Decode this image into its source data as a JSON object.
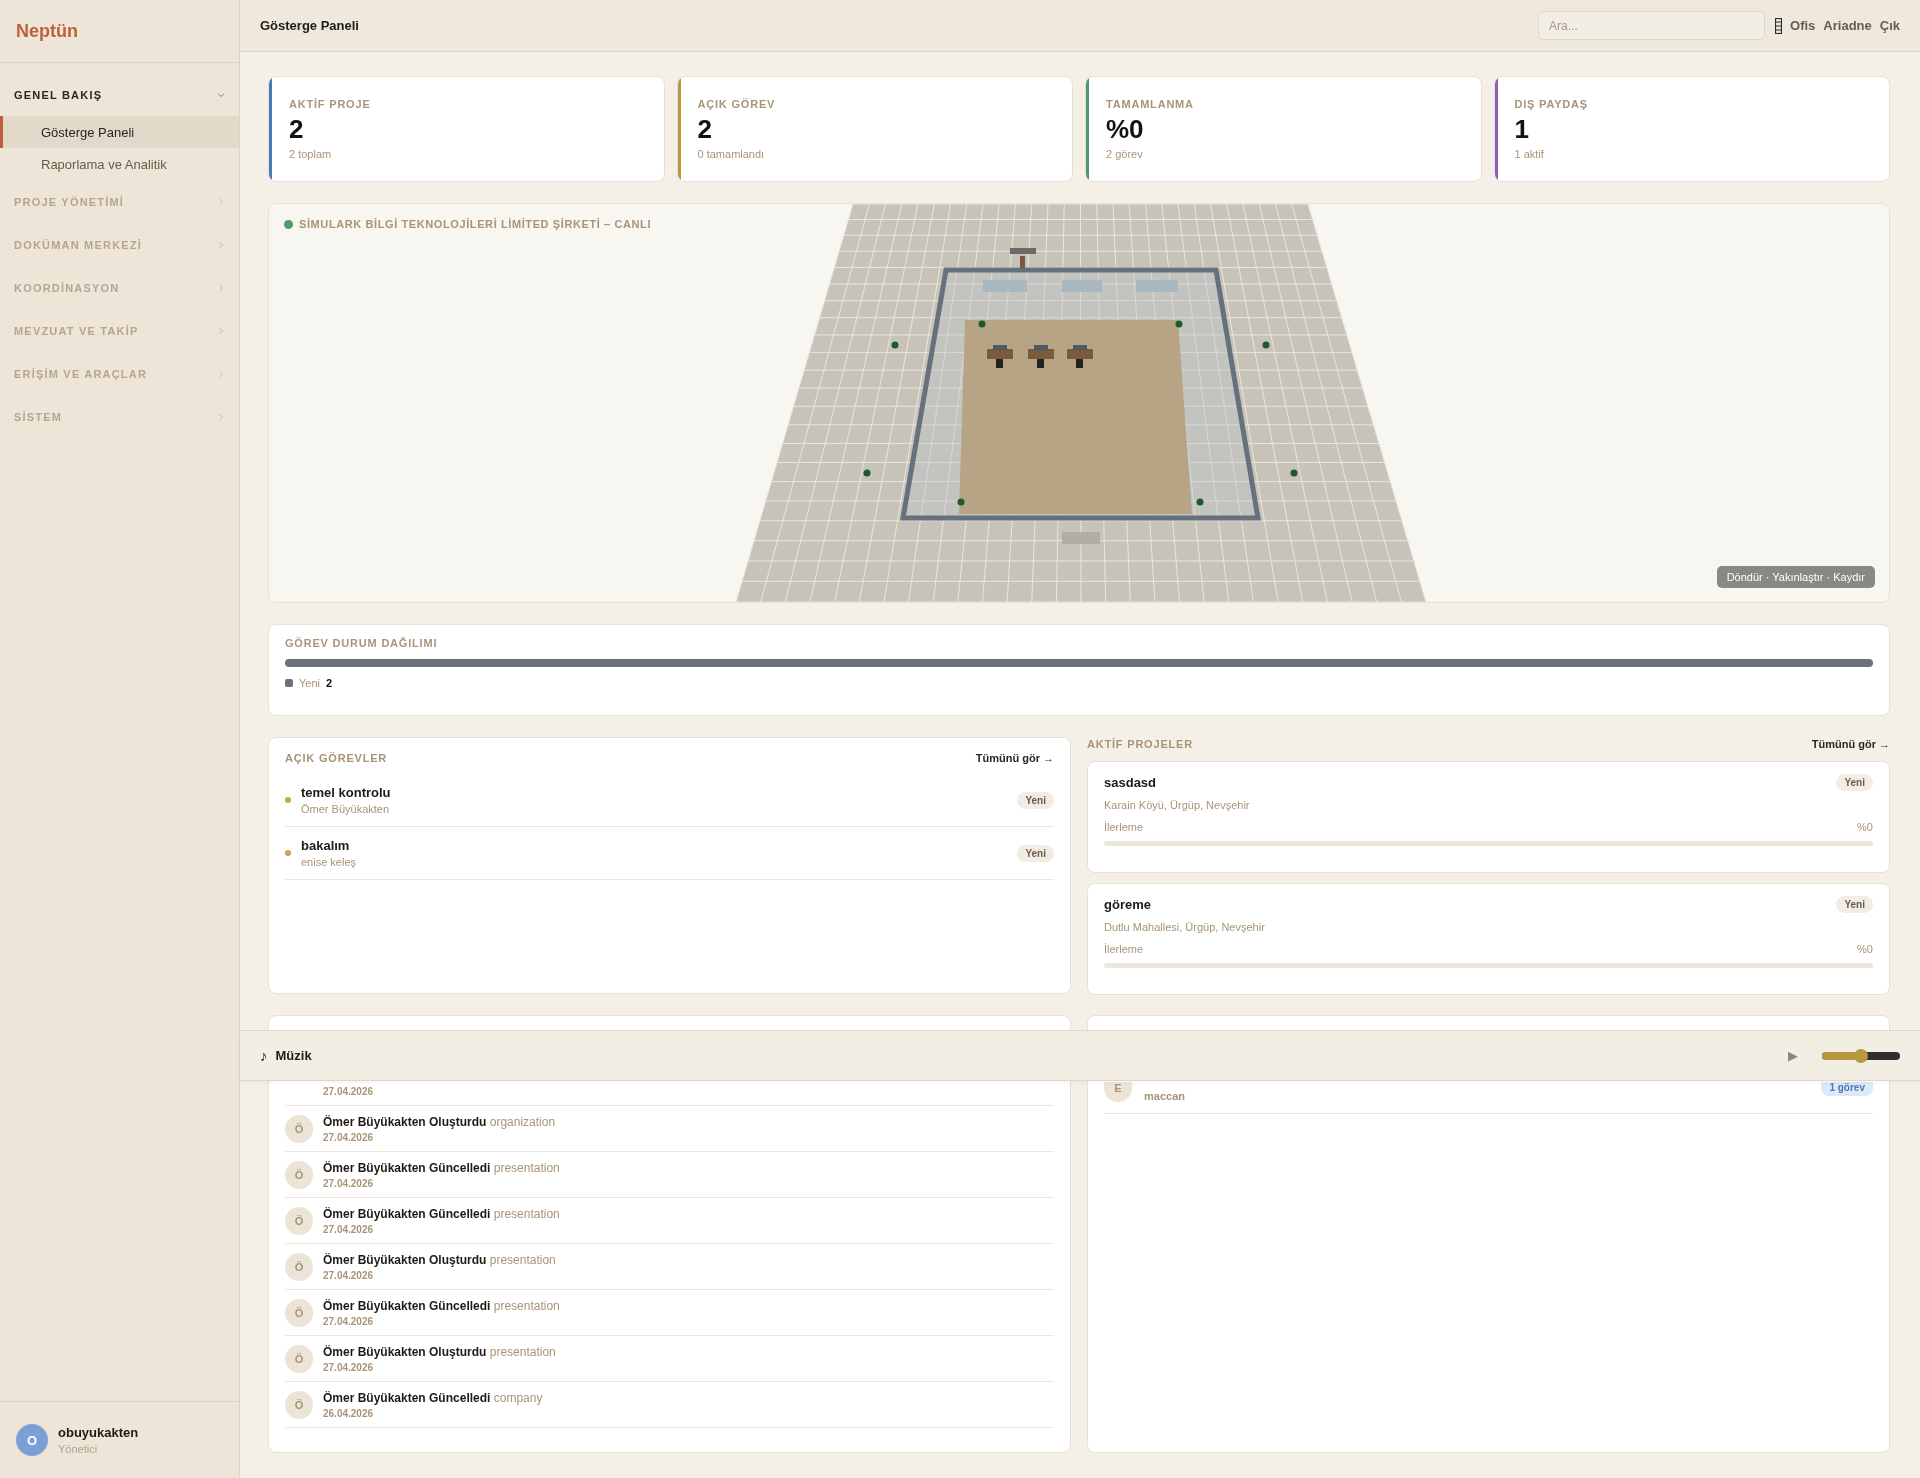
{
  "app": {
    "brand": "Neptün"
  },
  "sidebar": {
    "groups": [
      {
        "label": "GENEL BAKIŞ",
        "expanded": true,
        "children": [
          {
            "label": "Gösterge Paneli",
            "selected": true
          },
          {
            "label": "Raporlama ve Analitik",
            "selected": false
          }
        ]
      },
      {
        "label": "PROJE YÖNETİMİ",
        "expanded": false
      },
      {
        "label": "DOKÜMAN MERKEZİ",
        "expanded": false
      },
      {
        "label": "KOORDİNASYON",
        "expanded": false
      },
      {
        "label": "MEVZUAT VE TAKİP",
        "expanded": false
      },
      {
        "label": "ERİŞİM VE ARAÇLAR",
        "expanded": false
      },
      {
        "label": "SİSTEM",
        "expanded": false
      }
    ],
    "user": {
      "initial": "O",
      "name": "obuyukakten",
      "role": "Yönetici"
    }
  },
  "header": {
    "title": "Gösterge Paneli",
    "search": {
      "placeholder": "Ara..."
    },
    "links": [
      "Ofis",
      "Ariadne",
      "Çık"
    ]
  },
  "stats": [
    {
      "label": "AKTİF PROJE",
      "value": "2",
      "note": "2 toplam",
      "color": "#4a78b8"
    },
    {
      "label": "AÇIK GÖREV",
      "value": "2",
      "note": "0 tamamlandı",
      "color": "#b8973e"
    },
    {
      "label": "TAMAMLANMA",
      "value": "%0",
      "note": "2 görev",
      "color": "#4f9a68"
    },
    {
      "label": "DIŞ PAYDAŞ",
      "value": "1",
      "note": "1 aktif",
      "color": "#8a63b8"
    }
  ],
  "scene": {
    "title": "SİMULARK BİLGİ TEKNOLOJİLERİ LİMİTED ŞİRKETİ – CANLI",
    "live": true,
    "hint": "Döndür · Yakınlaştır · Kaydır"
  },
  "distribution": {
    "title": "GÖREV DURUM DAĞILIMI",
    "segments": [
      {
        "label": "Yeni",
        "count": "2",
        "color": "#6b7079",
        "level": 1
      }
    ]
  },
  "open_tasks": {
    "title": "AÇIK GÖREVLER",
    "link": "Tümünü gör →",
    "items": [
      {
        "title": "temel kontrolu",
        "assignee": "Ömer Büyükakten",
        "badge": "Yeni",
        "color": "#c9a24a"
      },
      {
        "title": "bakalım",
        "assignee": "enise keleş",
        "badge": "Yeni",
        "color": "#c9a24a"
      }
    ]
  },
  "active_projects": {
    "title": "AKTİF PROJELER",
    "link": "Tümünü gör →",
    "items": [
      {
        "name": "sasdasd",
        "location": "Karain Köyü, Ürgüp, Nevşehir",
        "badge": "Yeni",
        "progress_label": "İlerleme",
        "percent": "%0",
        "level": 0
      },
      {
        "name": "göreme",
        "location": "Dutlu Mahallesi, Ürgüp, Nevşehir",
        "badge": "Yeni",
        "progress_label": "İlerleme",
        "percent": "%0",
        "level": 0
      }
    ]
  },
  "activity": {
    "first_date": "27.04.2026",
    "items": [
      {
        "initial": "Ö",
        "text": "Ömer Büyükakten Oluşturdu",
        "target": "organization",
        "date": "27.04.2026"
      },
      {
        "initial": "Ö",
        "text": "Ömer Büyükakten Güncelledi",
        "target": "presentation",
        "date": "27.04.2026"
      },
      {
        "initial": "Ö",
        "text": "Ömer Büyükakten Güncelledi",
        "target": "presentation",
        "date": "27.04.2026"
      },
      {
        "initial": "Ö",
        "text": "Ömer Büyükakten Oluşturdu",
        "target": "presentation",
        "date": "27.04.2026"
      },
      {
        "initial": "Ö",
        "text": "Ömer Büyükakten Güncelledi",
        "target": "presentation",
        "date": "27.04.2026"
      },
      {
        "initial": "Ö",
        "text": "Ömer Büyükakten Oluşturdu",
        "target": "presentation",
        "date": "27.04.2026"
      },
      {
        "initial": "Ö",
        "text": "Ömer Büyükakten Güncelledi",
        "target": "company",
        "date": "26.04.2026"
      }
    ]
  },
  "stakeholders": {
    "items": [
      {
        "initial": "E",
        "name": "maccan",
        "badge": "1 görev"
      }
    ]
  },
  "music": {
    "icon": "♪",
    "title": "Müzik",
    "play": "▶",
    "volume": {
      "level": 0.5
    }
  }
}
